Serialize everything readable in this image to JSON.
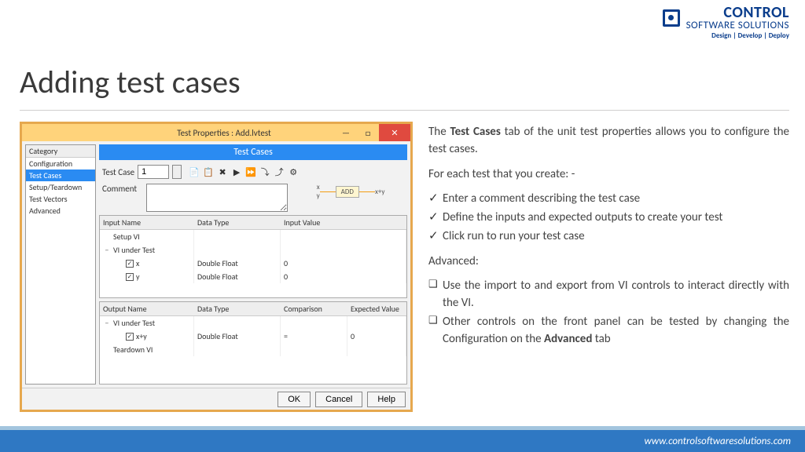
{
  "brand": {
    "name": "CONTROL",
    "sub": "SOFTWARE SOLUTIONS",
    "tagline": "Design | Develop | Deploy"
  },
  "slide_title": "Adding test cases",
  "window": {
    "title": "Test Properties : Add.lvtest",
    "titlebar_buttons": {
      "min": "—",
      "max": "□",
      "close": "✕"
    },
    "sidebar": {
      "header": "Category",
      "items": [
        {
          "label": "Configuration",
          "selected": false
        },
        {
          "label": "Test Cases",
          "selected": true
        },
        {
          "label": "Setup/Teardown",
          "selected": false
        },
        {
          "label": "Test Vectors",
          "selected": false
        },
        {
          "label": "Advanced",
          "selected": false
        }
      ]
    },
    "banner": "Test Cases",
    "case_row": {
      "label": "Test Case",
      "value": "1"
    },
    "toolbar_icons": [
      {
        "name": "new-case-icon",
        "glyph": "📄"
      },
      {
        "name": "copy-case-icon",
        "glyph": "📋"
      },
      {
        "name": "delete-case-icon",
        "glyph": "✖"
      },
      {
        "name": "run-icon",
        "glyph": "▶"
      },
      {
        "name": "run-all-icon",
        "glyph": "⏩"
      },
      {
        "name": "import-icon",
        "glyph": "⤵"
      },
      {
        "name": "export-icon",
        "glyph": "⤴"
      },
      {
        "name": "configure-icon",
        "glyph": "⚙"
      }
    ],
    "comment_label": "Comment",
    "diagram": {
      "in1": "x",
      "in2": "y",
      "op": "ADD",
      "out": "x+y"
    },
    "inputs": {
      "columns": [
        "Input Name",
        "Data Type",
        "Input Value"
      ],
      "rows": [
        {
          "indent": 0,
          "toggle": "",
          "check": false,
          "name": "Setup VI",
          "type": "",
          "value": ""
        },
        {
          "indent": 0,
          "toggle": "−",
          "check": false,
          "name": "VI under Test",
          "type": "",
          "value": ""
        },
        {
          "indent": 1,
          "toggle": "",
          "check": true,
          "name": "x",
          "type": "Double Float",
          "value": "0"
        },
        {
          "indent": 1,
          "toggle": "",
          "check": true,
          "name": "y",
          "type": "Double Float",
          "value": "0"
        }
      ]
    },
    "outputs": {
      "columns": [
        "Output Name",
        "Data Type",
        "Comparison",
        "Expected Value"
      ],
      "rows": [
        {
          "indent": 0,
          "toggle": "−",
          "check": false,
          "name": "VI under Test",
          "type": "",
          "comp": "",
          "exp": ""
        },
        {
          "indent": 1,
          "toggle": "",
          "check": true,
          "name": "x+y",
          "type": "Double Float",
          "comp": "=",
          "exp": "0"
        },
        {
          "indent": 0,
          "toggle": "",
          "check": false,
          "name": "Teardown VI",
          "type": "",
          "comp": "",
          "exp": ""
        }
      ]
    },
    "buttons": {
      "ok": "OK",
      "cancel": "Cancel",
      "help": "Help"
    }
  },
  "text": {
    "p1a": "The ",
    "p1b": "Test Cases",
    "p1c": " tab of the unit test properties allows you to configure the test cases.",
    "p2": "For each test that you create: -",
    "checks": [
      "Enter a comment describing the test case",
      "Define the inputs and expected outputs to create your test",
      "Click run to run your test case"
    ],
    "p3": "Advanced:",
    "squares_0": "Use the import to and export from VI controls to interact directly with the VI.",
    "squares_1a": "Other controls on the front panel can be tested by changing the Configuration on the ",
    "squares_1b": "Advanced",
    "squares_1c": " tab"
  },
  "footer_url": "www.controlsoftwaresolutions.com"
}
